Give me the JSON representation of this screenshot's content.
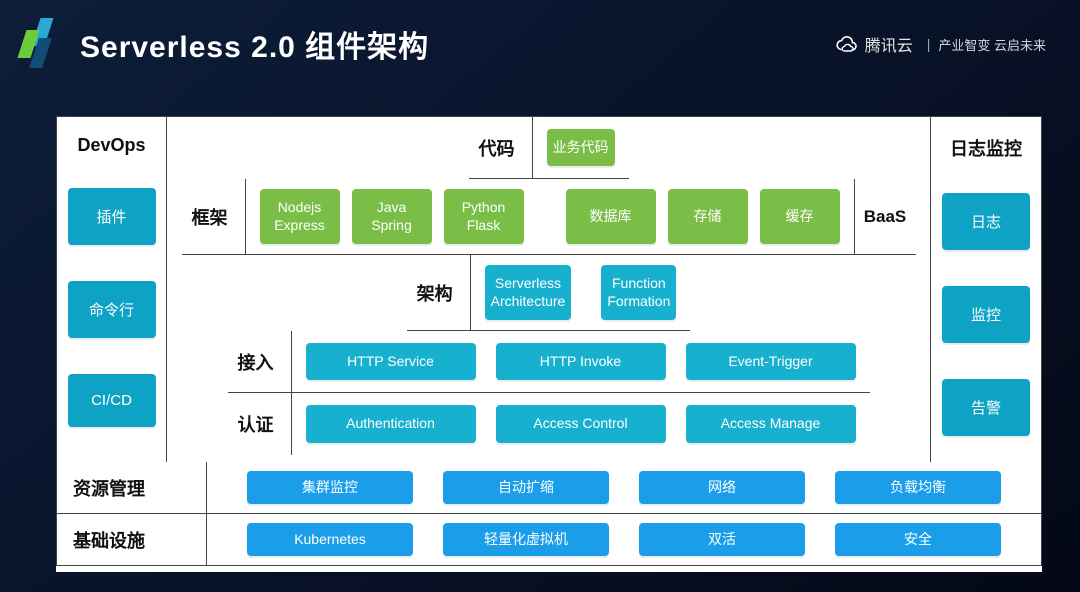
{
  "header": {
    "title": "Serverless 2.0 组件架构",
    "brand_name": "腾讯云",
    "brand_tagline": "产业智变 云启未来"
  },
  "left_col": {
    "title": "DevOps",
    "buttons": [
      "插件",
      "命令行",
      "CI/CD"
    ]
  },
  "right_col": {
    "title": "日志监控",
    "buttons": [
      "日志",
      "监控",
      "告警"
    ]
  },
  "rows": {
    "code": {
      "label": "代码",
      "blocks": [
        "业务代码"
      ]
    },
    "framework": {
      "label": "框架",
      "runtimes": [
        "Nodejs\nExpress",
        "Java\nSpring",
        "Python\nFlask"
      ],
      "baas_items": [
        "数据库",
        "存储",
        "缓存"
      ],
      "baas_label": "BaaS"
    },
    "arch": {
      "label": "架构",
      "blocks": [
        "Serverless\nArchitecture",
        "Function\nFormation"
      ]
    },
    "access": {
      "label": "接入",
      "blocks": [
        "HTTP Service",
        "HTTP Invoke",
        "Event-Trigger"
      ]
    },
    "auth": {
      "label": "认证",
      "blocks": [
        "Authentication",
        "Access Control",
        "Access Manage"
      ]
    }
  },
  "bottom": {
    "resource": {
      "label": "资源管理",
      "blocks": [
        "集群监控",
        "自动扩缩",
        "网络",
        "负载均衡"
      ]
    },
    "infra": {
      "label": "基础设施",
      "blocks": [
        "Kubernetes",
        "轻量化虚拟机",
        "双活",
        "安全"
      ]
    }
  },
  "colors": {
    "green": "#7bbe47",
    "cyan": "#17b1cf",
    "blue": "#1b9eea",
    "side": "#0ea2c4"
  }
}
